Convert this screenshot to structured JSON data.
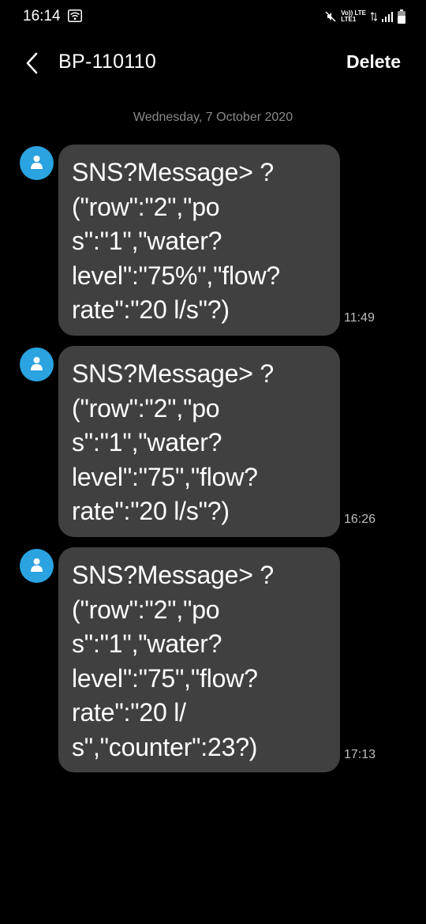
{
  "status_bar": {
    "time": "16:14",
    "network_top": "Vo)) LTE",
    "network_bottom": "LTE1",
    "lte_label": "LTE"
  },
  "header": {
    "contact": "BP-110110",
    "delete_label": "Delete"
  },
  "date_divider": "Wednesday, 7 October 2020",
  "messages": [
    {
      "text": "SNS?Message> ?\n(\"row\":\"2\",\"po\ns\":\"1\",\"water?\nlevel\":\"75%\",\"flow?\nrate\":\"20 l/s\"?)",
      "time": "11:49"
    },
    {
      "text": "SNS?Message> ?\n(\"row\":\"2\",\"po\ns\":\"1\",\"water?\nlevel\":\"75\",\"flow?\nrate\":\"20 l/s\"?)",
      "time": "16:26"
    },
    {
      "text": "SNS?Message> ?\n(\"row\":\"2\",\"po\ns\":\"1\",\"water?\nlevel\":\"75\",\"flow?\nrate\":\"20 l/\ns\",\"counter\":23?)",
      "time": "17:13"
    }
  ],
  "colors": {
    "background": "#000000",
    "bubble": "#404040",
    "avatar": "#2aa3e0",
    "date_text": "#8a8a8a"
  }
}
